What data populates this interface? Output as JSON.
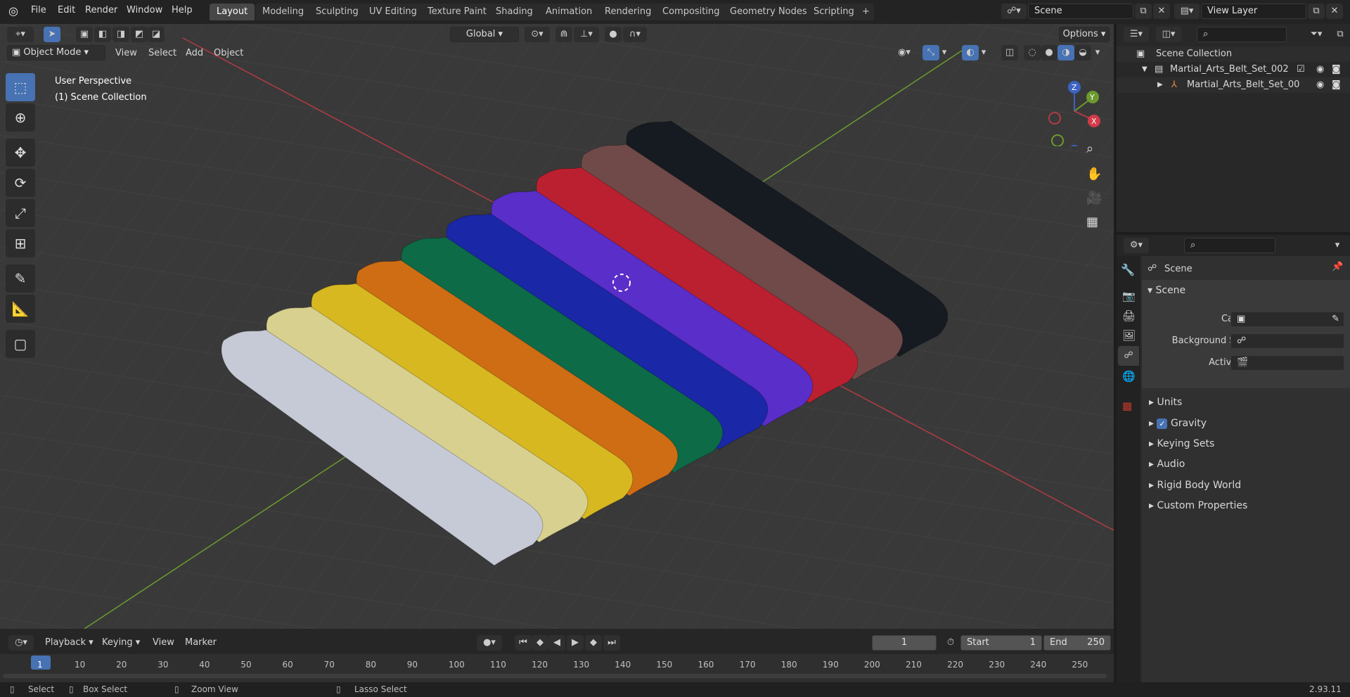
{
  "topbar": {
    "menus": [
      "File",
      "Edit",
      "Render",
      "Window",
      "Help"
    ],
    "workspaces": [
      "Layout",
      "Modeling",
      "Sculpting",
      "UV Editing",
      "Texture Paint",
      "Shading",
      "Animation",
      "Rendering",
      "Compositing",
      "Geometry Nodes",
      "Scripting"
    ],
    "active_workspace": "Layout",
    "add_tab": "+",
    "scene_label": "Scene",
    "view_layer_label": "View Layer"
  },
  "viewport_header": {
    "mode": "Object Mode",
    "menus": [
      "View",
      "Select",
      "Add",
      "Object"
    ],
    "orientation": "Global",
    "options": "Options"
  },
  "viewport": {
    "perspective": "User Perspective",
    "collection": "(1) Scene Collection",
    "gizmo": {
      "z": "Z",
      "y": "Y",
      "x": "X"
    },
    "belt_colors": [
      "#c6cad6",
      "#d8d08e",
      "#d8b820",
      "#cf6d14",
      "#0d6b48",
      "#1a27a7",
      "#5a2ec9",
      "#bb2030",
      "#6f4a48",
      "#161a21"
    ]
  },
  "timeline": {
    "menus": [
      "Playback",
      "Keying",
      "View",
      "Marker"
    ],
    "current_frame": "1",
    "start_label": "Start",
    "start_value": "1",
    "end_label": "End",
    "end_value": "250",
    "ticks": [
      "1",
      "10",
      "20",
      "30",
      "40",
      "50",
      "60",
      "70",
      "80",
      "90",
      "100",
      "110",
      "120",
      "130",
      "140",
      "150",
      "160",
      "170",
      "180",
      "190",
      "200",
      "210",
      "220",
      "230",
      "240",
      "250"
    ]
  },
  "statusbar": {
    "select": "Select",
    "box_select": "Box Select",
    "zoom_view": "Zoom View",
    "lasso_select": "Lasso Select",
    "version": "2.93.11"
  },
  "outliner": {
    "root": "Scene Collection",
    "collection": "Martial_Arts_Belt_Set_002",
    "object": "Martial_Arts_Belt_Set_00"
  },
  "properties": {
    "context_title": "Scene",
    "panel_title": "Scene",
    "camera_label": "Camera",
    "background_scene_label": "Background Scene",
    "active_clip_label": "Active Clip",
    "sections": [
      "Units",
      "Gravity",
      "Keying Sets",
      "Audio",
      "Rigid Body World",
      "Custom Properties"
    ],
    "gravity_checked": true
  },
  "colors": {
    "accent": "#4772b3",
    "x_axis": "#b13b45",
    "y_axis": "#6c9a2f"
  }
}
